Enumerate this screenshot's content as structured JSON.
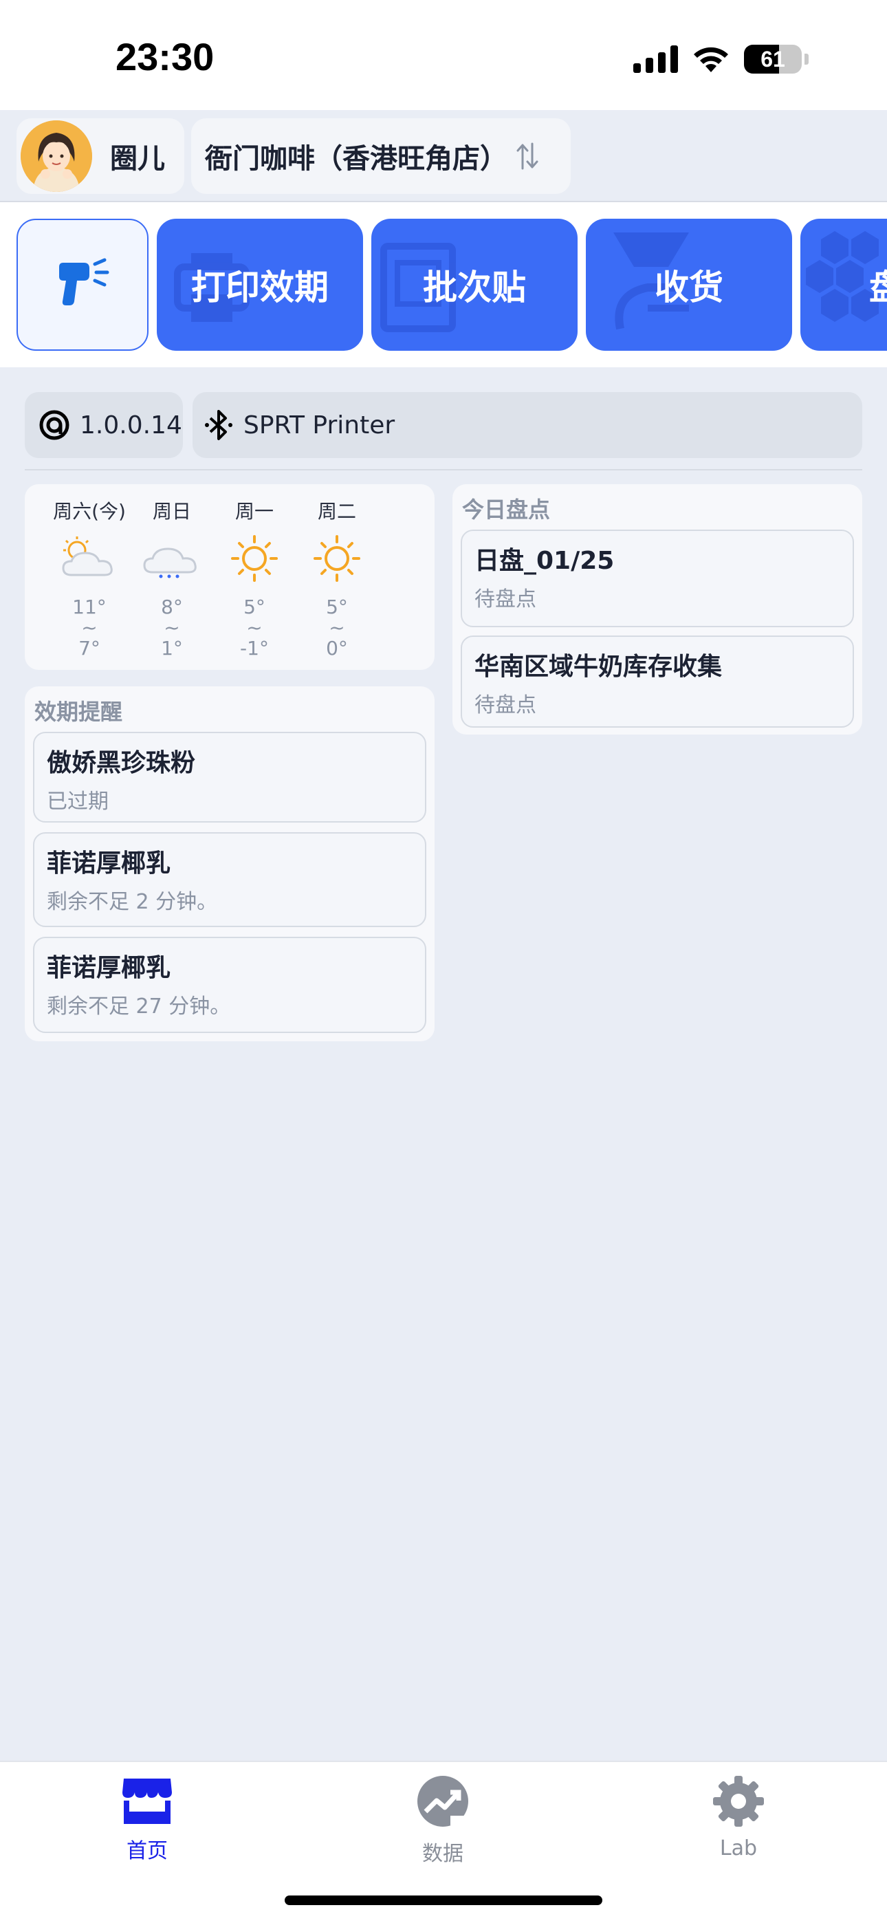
{
  "status_bar": {
    "time": "23:30",
    "battery": "61",
    "battery_level": 0.61,
    "icons": [
      "cellular-signal-icon",
      "wifi-icon",
      "battery-icon"
    ]
  },
  "header": {
    "user_name": "圈儿",
    "store_name": "衙门咖啡（香港旺角店）",
    "icons": [
      "avatar",
      "swap-arrows-icon"
    ]
  },
  "actions": {
    "scan_icon": "scanner-gun-icon",
    "items": [
      {
        "label": "打印效期",
        "icon": "printer-icon"
      },
      {
        "label": "批次贴",
        "icon": "label-tag-icon"
      },
      {
        "label": "收货",
        "icon": "receive-goods-icon"
      },
      {
        "label": "盘",
        "icon": "hexagon-pattern-icon"
      }
    ]
  },
  "info": {
    "version": "1.0.0.14",
    "printer": "SPRT Printer",
    "icons": [
      "version-ring-icon",
      "bluetooth-icon"
    ]
  },
  "weather": {
    "days": [
      {
        "name": "周六(今)",
        "icon": "partly-cloudy-icon",
        "high": "11°",
        "sep": "~",
        "low": "7°"
      },
      {
        "name": "周日",
        "icon": "light-rain-icon",
        "high": "8°",
        "sep": "~",
        "low": "1°"
      },
      {
        "name": "周一",
        "icon": "sunny-icon",
        "high": "5°",
        "sep": "~",
        "low": "-1°"
      },
      {
        "name": "周二",
        "icon": "sunny-icon",
        "high": "5°",
        "sep": "~",
        "low": "0°"
      }
    ]
  },
  "expiry": {
    "title": "效期提醒",
    "items": [
      {
        "title": "傲娇黑珍珠粉",
        "subtitle": "已过期"
      },
      {
        "title": "菲诺厚椰乳",
        "subtitle": "剩余不足 2 分钟。"
      },
      {
        "title": "菲诺厚椰乳",
        "subtitle": "剩余不足 27 分钟。"
      }
    ]
  },
  "stocktake": {
    "title": "今日盘点",
    "items": [
      {
        "title": "日盘_01/25",
        "subtitle": "待盘点"
      },
      {
        "title": "华南区域牛奶库存收集",
        "subtitle": "待盘点"
      }
    ]
  },
  "tabs": [
    {
      "label": "首页",
      "icon": "store-icon",
      "active": true
    },
    {
      "label": "数据",
      "icon": "chart-trend-icon",
      "active": false
    },
    {
      "label": "Lab",
      "icon": "gear-icon",
      "active": false
    }
  ],
  "colors": {
    "accent": "#3b6cf6",
    "tab_active": "#1a22e8",
    "tab_inactive": "#8a8f99",
    "sun": "#f5a623"
  }
}
